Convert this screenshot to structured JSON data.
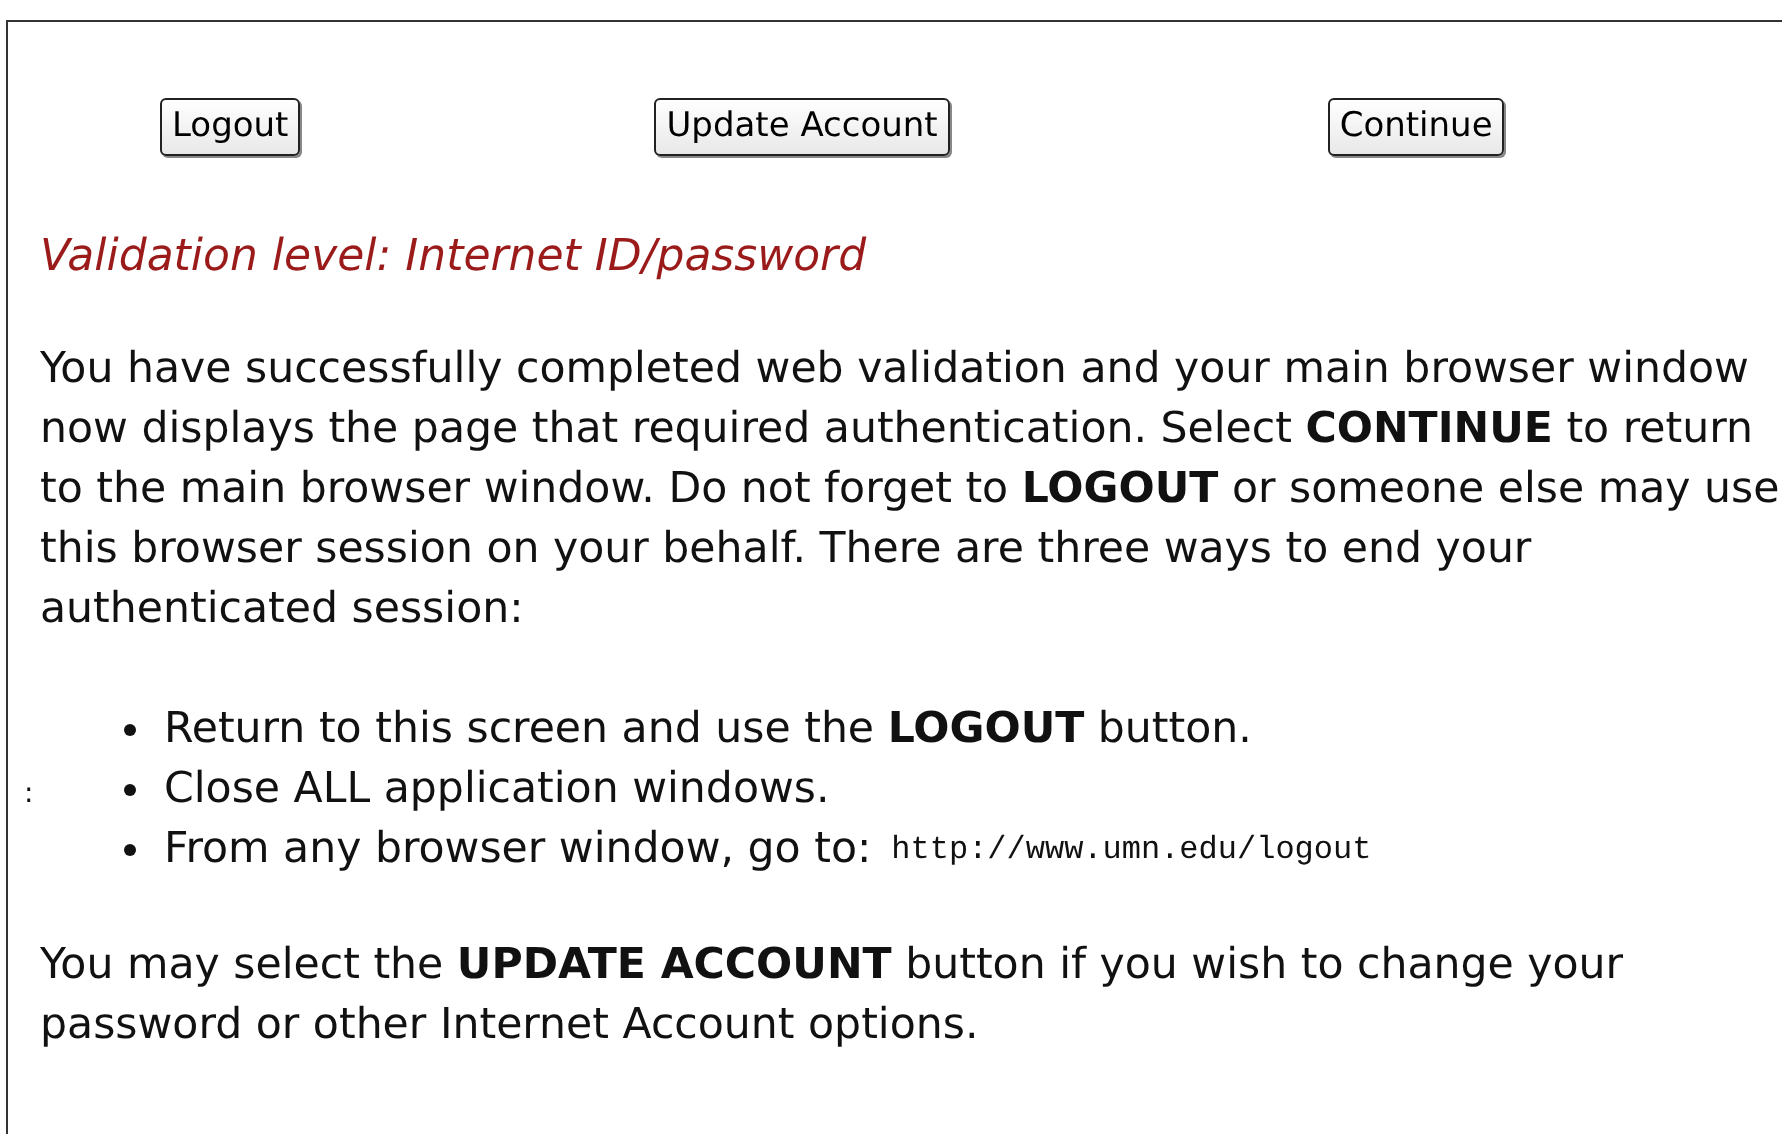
{
  "buttons": [
    {
      "label": "Logout"
    },
    {
      "label": "Update Account"
    },
    {
      "label": "Continue"
    }
  ],
  "validation_level": "Validation level: Internet ID/password",
  "intro": "You have successfully completed web validation and your main browser window now displays the page that required authentication. Select **CONTINUE** to return to the main browser window. Do not forget to **LOGOUT** or someone else may use this browser session on your behalf. There are three ways to end your authenticated session:",
  "side_mark": ":",
  "ways": [
    {
      "text": "Return to this screen and use the **LOGOUT** button."
    },
    {
      "text": "Close ALL application windows."
    },
    {
      "text": "From any browser window, go to:",
      "code": "http://www.umn.edu/logout"
    }
  ],
  "closing": "You may select the **UPDATE ACCOUNT** button if you wish to change your password or other Internet Account options."
}
